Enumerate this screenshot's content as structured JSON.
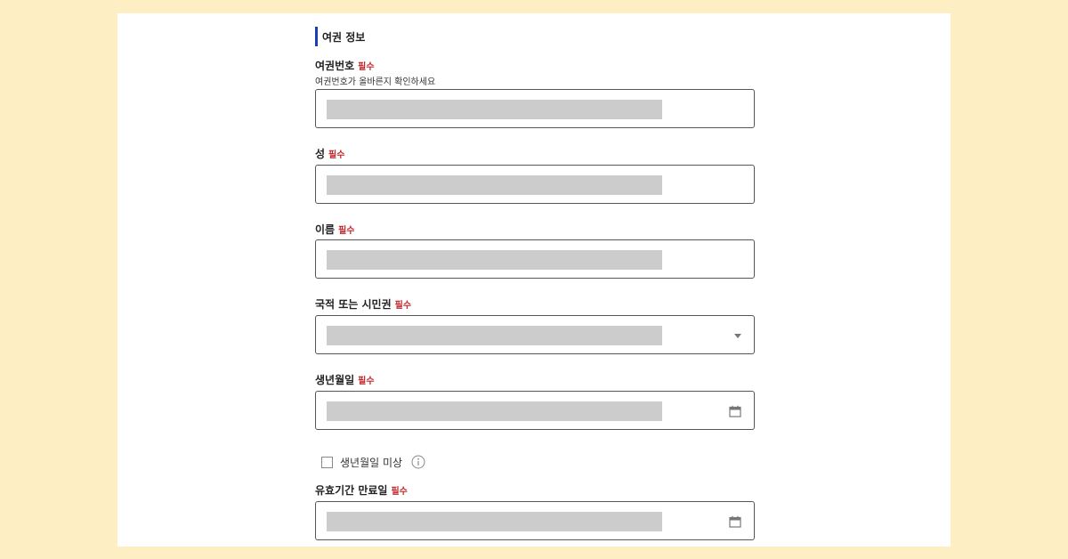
{
  "section": {
    "title": "여권 정보"
  },
  "required_tag": "필수",
  "fields": {
    "passport_number": {
      "label": "여권번호",
      "hint": "여권번호가 올바른지 확인하세요"
    },
    "surname": {
      "label": "성"
    },
    "given_name": {
      "label": "이름"
    },
    "nationality": {
      "label": "국적 또는 시민권",
      "icon": "chevron-down-icon"
    },
    "birth_date": {
      "label": "생년월일",
      "icon": "calendar-icon"
    },
    "birth_unknown": {
      "label": "생년월일 미상",
      "checked": false,
      "icon": "info-icon"
    },
    "expiry_date": {
      "label": "유효기간 만료일",
      "icon": "calendar-icon"
    }
  },
  "colors": {
    "page_background": "#fdeec4",
    "accent_bar": "#1a3fb5",
    "required": "#c0282d",
    "redaction": "#cccccc"
  }
}
